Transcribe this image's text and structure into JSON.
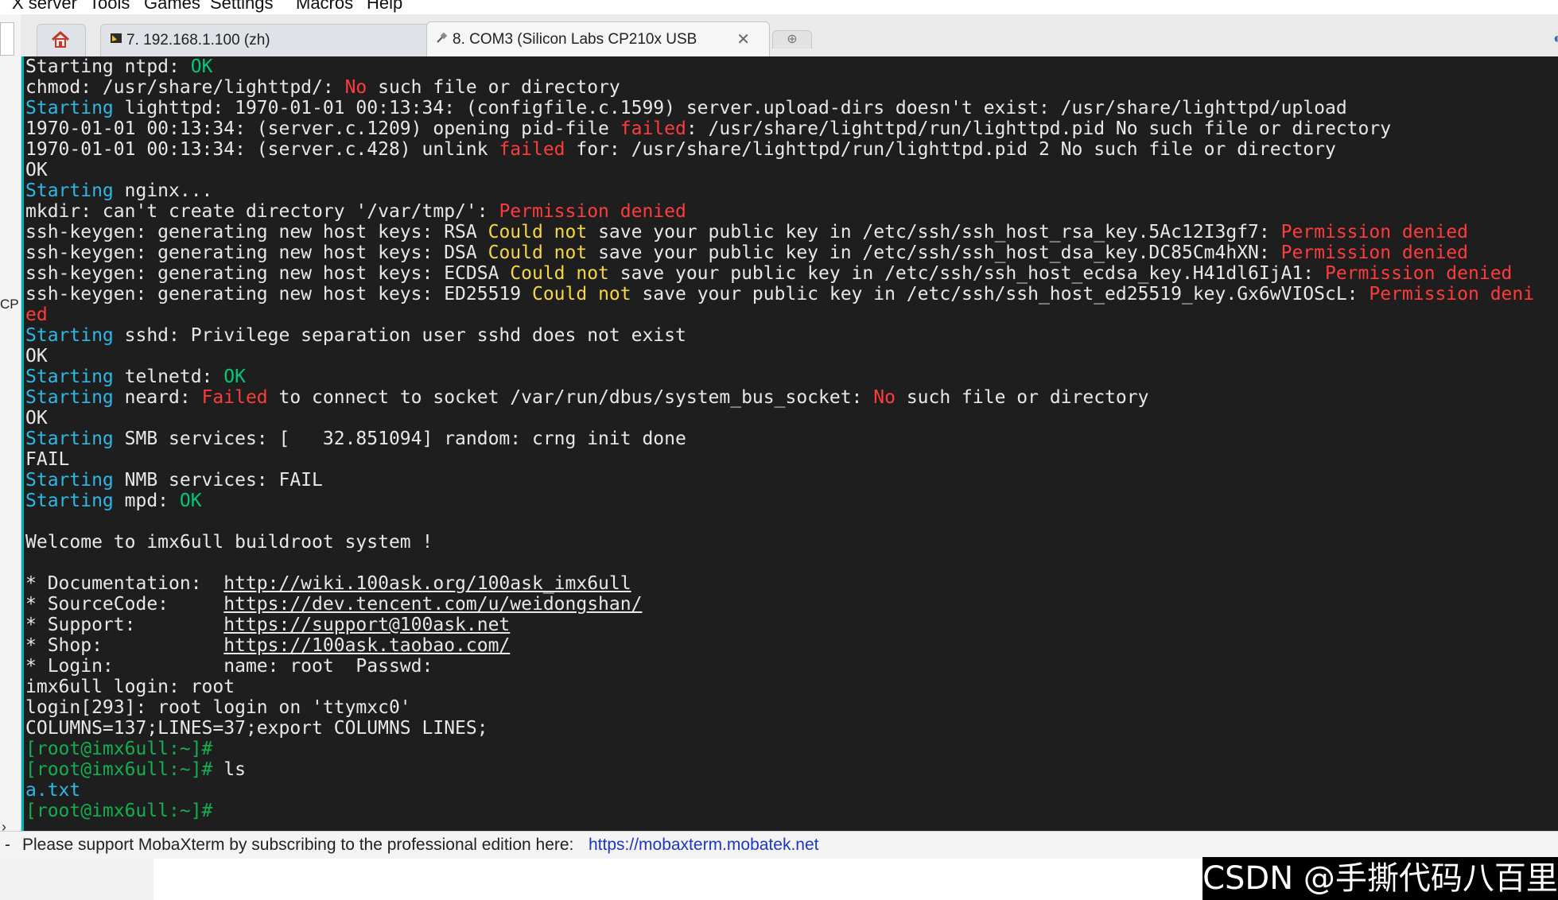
{
  "menu": {
    "items": [
      "X server",
      "Tools",
      "Games",
      "Settings",
      "Macros",
      "Help"
    ]
  },
  "left_strip": {
    "label": "CP",
    "arrow": "›"
  },
  "tabs": {
    "home_icon": "home-icon",
    "tab7_label": "7. 192.168.1.100 (zh)",
    "tab8_label": "8. COM3  (Silicon Labs CP210x USB",
    "close_glyph": "✕",
    "new_tab_glyph": "⊕"
  },
  "terminal": {
    "background": "#1e1e1e",
    "lines": [
      [
        [
          "Starting ntpd: ",
          "w"
        ],
        [
          "OK",
          "g"
        ]
      ],
      [
        [
          "chmod: /usr/share/lighttpd/: ",
          "w"
        ],
        [
          "No",
          "r"
        ],
        [
          " such file or directory",
          "w"
        ]
      ],
      [
        [
          "Starting",
          "c"
        ],
        [
          " lighttpd: 1970-01-01 00:13:34: (configfile.c.1599) server.upload-dirs doesn't exist: /usr/share/lighttpd/upload",
          "w"
        ]
      ],
      [
        [
          "1970-01-01 00:13:34: (server.c.1209) opening pid-file ",
          "w"
        ],
        [
          "failed",
          "r"
        ],
        [
          ": /usr/share/lighttpd/run/lighttpd.pid No such file or directory",
          "w"
        ]
      ],
      [
        [
          "1970-01-01 00:13:34: (server.c.428) unlink ",
          "w"
        ],
        [
          "failed",
          "r"
        ],
        [
          " for: /usr/share/lighttpd/run/lighttpd.pid 2 No such file or directory",
          "w"
        ]
      ],
      [
        [
          "OK",
          "w"
        ]
      ],
      [
        [
          "Starting",
          "c"
        ],
        [
          " nginx...",
          "w"
        ]
      ],
      [
        [
          "mkdir: can't create directory '/var/tmp/': ",
          "w"
        ],
        [
          "Permission denied",
          "r"
        ]
      ],
      [
        [
          "ssh-keygen: generating new host keys: RSA ",
          "w"
        ],
        [
          "Could not",
          "y"
        ],
        [
          " save your public key in /etc/ssh/ssh_host_rsa_key.5Ac12I3gf7: ",
          "w"
        ],
        [
          "Permission denied",
          "r"
        ]
      ],
      [
        [
          "ssh-keygen: generating new host keys: DSA ",
          "w"
        ],
        [
          "Could not",
          "y"
        ],
        [
          " save your public key in /etc/ssh/ssh_host_dsa_key.DC85Cm4hXN: ",
          "w"
        ],
        [
          "Permission denied",
          "r"
        ]
      ],
      [
        [
          "ssh-keygen: generating new host keys: ECDSA ",
          "w"
        ],
        [
          "Could not",
          "y"
        ],
        [
          " save your public key in /etc/ssh/ssh_host_ecdsa_key.H41dl6IjA1: ",
          "w"
        ],
        [
          "Permission denied",
          "r"
        ]
      ],
      [
        [
          "ssh-keygen: generating new host keys: ED25519 ",
          "w"
        ],
        [
          "Could not",
          "y"
        ],
        [
          " save your public key in /etc/ssh/ssh_host_ed25519_key.Gx6wVIOScL: ",
          "w"
        ],
        [
          "Permission deni",
          "r"
        ]
      ],
      [
        [
          "ed",
          "r"
        ]
      ],
      [
        [
          "Starting",
          "c"
        ],
        [
          " sshd: Privilege separation user sshd does not exist",
          "w"
        ]
      ],
      [
        [
          "OK",
          "w"
        ]
      ],
      [
        [
          "Starting",
          "c"
        ],
        [
          " telnetd: ",
          "w"
        ],
        [
          "OK",
          "g"
        ]
      ],
      [
        [
          "Starting",
          "c"
        ],
        [
          " neard: ",
          "w"
        ],
        [
          "Failed",
          "r"
        ],
        [
          " to connect to socket /var/run/dbus/system_bus_socket: ",
          "w"
        ],
        [
          "No",
          "r"
        ],
        [
          " such file or directory",
          "w"
        ]
      ],
      [
        [
          "OK",
          "w"
        ]
      ],
      [
        [
          "Starting",
          "c"
        ],
        [
          " SMB services: [   32.851094] random: crng init done",
          "w"
        ]
      ],
      [
        [
          "FAIL",
          "w"
        ]
      ],
      [
        [
          "Starting",
          "c"
        ],
        [
          " NMB services: FAIL",
          "w"
        ]
      ],
      [
        [
          "Starting",
          "c"
        ],
        [
          " mpd: ",
          "w"
        ],
        [
          "OK",
          "g"
        ]
      ],
      [],
      [
        [
          "Welcome to imx6ull buildroot system !",
          "w"
        ]
      ],
      [],
      [
        [
          "* Documentation:  ",
          "w"
        ],
        [
          "http://wiki.100ask.org/100ask_imx6ull",
          "u"
        ]
      ],
      [
        [
          "* SourceCode:     ",
          "w"
        ],
        [
          "https://dev.tencent.com/u/weidongshan/",
          "u"
        ]
      ],
      [
        [
          "* Support:        ",
          "w"
        ],
        [
          "https://support@100ask.net",
          "u"
        ]
      ],
      [
        [
          "* Shop:           ",
          "w"
        ],
        [
          "https://100ask.taobao.com/",
          "u"
        ]
      ],
      [
        [
          "* Login:          name: root  Passwd:",
          "w"
        ]
      ],
      [
        [
          "imx6ull login: root",
          "w"
        ]
      ],
      [
        [
          "login[293]: root login on 'ttymxc0'",
          "w"
        ]
      ],
      [
        [
          "COLUMNS=137;LINES=37;export COLUMNS LINES;",
          "w"
        ]
      ],
      [
        [
          "[root@imx6ull:~]#",
          "p"
        ]
      ],
      [
        [
          "[root@imx6ull:~]#",
          "p"
        ],
        [
          " ls",
          "w"
        ]
      ],
      [
        [
          "a.txt",
          "c"
        ]
      ],
      [
        [
          "[root@imx6ull:~]#",
          "p"
        ]
      ]
    ]
  },
  "status": {
    "dash": "-",
    "message": "Please support MobaXterm by subscribing to the professional edition here:",
    "link": "https://mobaxterm.mobatek.net"
  },
  "watermark": {
    "text": "CSDN @手撕代码八百里"
  }
}
